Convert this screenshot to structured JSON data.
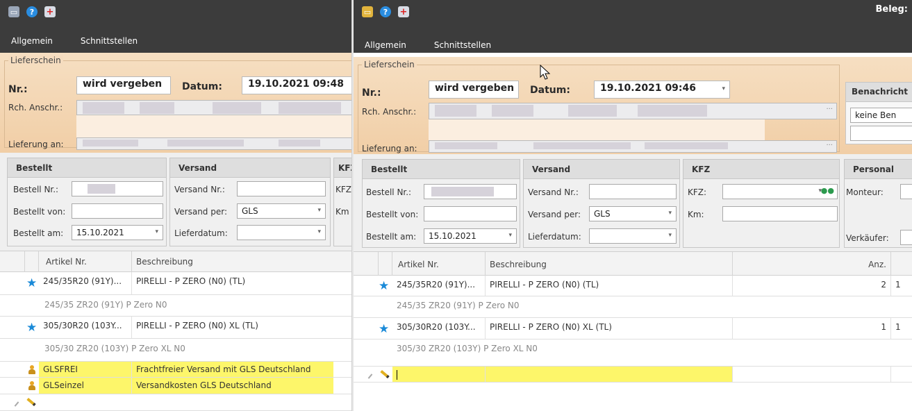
{
  "left": {
    "menu": [
      "Allgemein",
      "Schnittstellen"
    ],
    "group_title": "Lieferschein",
    "nr_label": "Nr.:",
    "nr_value": "wird vergeben",
    "datum_label": "Datum:",
    "datum_value": "19.10.2021 09:48",
    "rch_label": "Rch. Anschr.:",
    "lief_label": "Lieferung an:",
    "bestellt": {
      "title": "Bestellt",
      "nr_label": "Bestell Nr.:",
      "von_label": "Bestellt von:",
      "am_label": "Bestellt am:",
      "am_value": "15.10.2021"
    },
    "versand": {
      "title": "Versand",
      "nr_label": "Versand Nr.:",
      "per_label": "Versand per:",
      "per_value": "GLS",
      "datum_label": "Lieferdatum:"
    },
    "kfz": {
      "title": "KFZ",
      "kfz_label": "KFZ",
      "km_label": "Km"
    },
    "grid": {
      "col_artikel": "Artikel Nr.",
      "col_beschreibung": "Beschreibung",
      "rows": [
        {
          "artikel": "245/35R20 (91Y)...",
          "beschreibung": "PIRELLI - P ZERO (N0) (TL)",
          "sub": "245/35 ZR20 (91Y) P Zero N0"
        },
        {
          "artikel": "305/30R20 (103Y...",
          "beschreibung": "PIRELLI - P ZERO (N0) XL (TL)",
          "sub": "305/30 ZR20 (103Y) P Zero XL N0"
        },
        {
          "artikel": "GLSFREI",
          "beschreibung": "Frachtfreier Versand mit GLS Deutschland"
        },
        {
          "artikel": "GLSeinzel",
          "beschreibung": "Versandkosten GLS Deutschland"
        }
      ]
    }
  },
  "right": {
    "beleg_label": "Beleg:",
    "menu": [
      "Allgemein",
      "Schnittstellen"
    ],
    "group_title": "Lieferschein",
    "nr_label": "Nr.:",
    "nr_value": "wird vergeben",
    "datum_label": "Datum:",
    "datum_value": "19.10.2021 09:46",
    "rch_label": "Rch. Anschr.:",
    "lief_label": "Lieferung an:",
    "benach_title": "Benachricht",
    "benach_value": "keine Ben",
    "bestellt": {
      "title": "Bestellt",
      "nr_label": "Bestell Nr.:",
      "von_label": "Bestellt von:",
      "am_label": "Bestellt am:",
      "am_value": "15.10.2021"
    },
    "versand": {
      "title": "Versand",
      "nr_label": "Versand Nr.:",
      "per_label": "Versand per:",
      "per_value": "GLS",
      "datum_label": "Lieferdatum:"
    },
    "kfz": {
      "title": "KFZ",
      "kfz_label": "KFZ:",
      "km_label": "Km:"
    },
    "personal": {
      "title": "Personal",
      "monteur_label": "Monteur:",
      "verkaeufer_label": "Verkäufer:"
    },
    "grid": {
      "col_artikel": "Artikel Nr.",
      "col_beschreibung": "Beschreibung",
      "col_anz": "Anz.",
      "rows": [
        {
          "artikel": "245/35R20 (91Y)...",
          "beschreibung": "PIRELLI - P ZERO (N0) (TL)",
          "anz": "2",
          "extra": "1",
          "sub": "245/35 ZR20 (91Y) P Zero N0"
        },
        {
          "artikel": "305/30R20 (103Y...",
          "beschreibung": "PIRELLI - P ZERO (N0) XL (TL)",
          "anz": "1",
          "extra": "1",
          "sub": "305/30 ZR20 (103Y) P Zero XL N0"
        }
      ]
    }
  },
  "icons": {
    "left": [
      "message-icon",
      "help-icon",
      "add-icon"
    ],
    "right": [
      "message-icon",
      "help-icon",
      "add-icon"
    ]
  },
  "colors": {
    "header": "#3c3c3c",
    "orange": "#f3d4b0",
    "highlight": "#fdf66a",
    "star": "#1a8ad8"
  }
}
